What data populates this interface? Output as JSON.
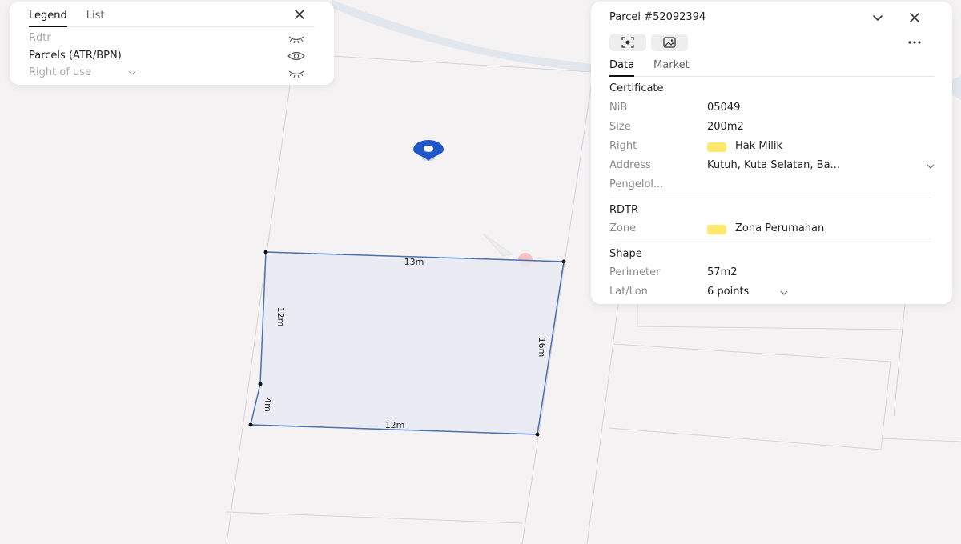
{
  "map": {
    "parcel_edges": {
      "top": "13m",
      "left_upper": "12m",
      "left_lower": "4m",
      "right": "16m",
      "bottom": "12m"
    },
    "colors": {
      "parcel_stroke": "#4a72b0",
      "parcel_fill": "#e9ebf2",
      "marker": "#1f57c8",
      "river": "#e2e6ed"
    }
  },
  "legend": {
    "tabs": [
      "Legend",
      "List"
    ],
    "active_tab": "Legend",
    "items": [
      {
        "label": "Rdtr",
        "visible": false,
        "icon": "eye-closed-icon"
      },
      {
        "label": "Parcels (ATR/BPN)",
        "visible": true,
        "icon": "eye-icon"
      },
      {
        "label": "Right of use",
        "visible": false,
        "icon": "eye-closed-icon"
      }
    ]
  },
  "parcel": {
    "title": "Parcel #52092394",
    "tabs": [
      "Data",
      "Market"
    ],
    "active_tab": "Data",
    "certificate": {
      "heading": "Certificate",
      "nib_label": "NiB",
      "nib_value": "05049",
      "size_label": "Size",
      "size_value": "200m2",
      "right_label": "Right",
      "right_value": "Hak Milik",
      "address_label": "Address",
      "address_value": "Kutuh, Kuta Selatan, Ba...",
      "manager_label": "Pengelol..."
    },
    "rdtr": {
      "heading": "RDTR",
      "zone_label": "Zone",
      "zone_value": "Zona Perumahan"
    },
    "shape": {
      "heading": "Shape",
      "perimeter_label": "Perimeter",
      "perimeter_value": "57m2",
      "latlon_label": "Lat/Lon",
      "latlon_value": "6 points"
    },
    "swatch_color": "#fde96b"
  }
}
